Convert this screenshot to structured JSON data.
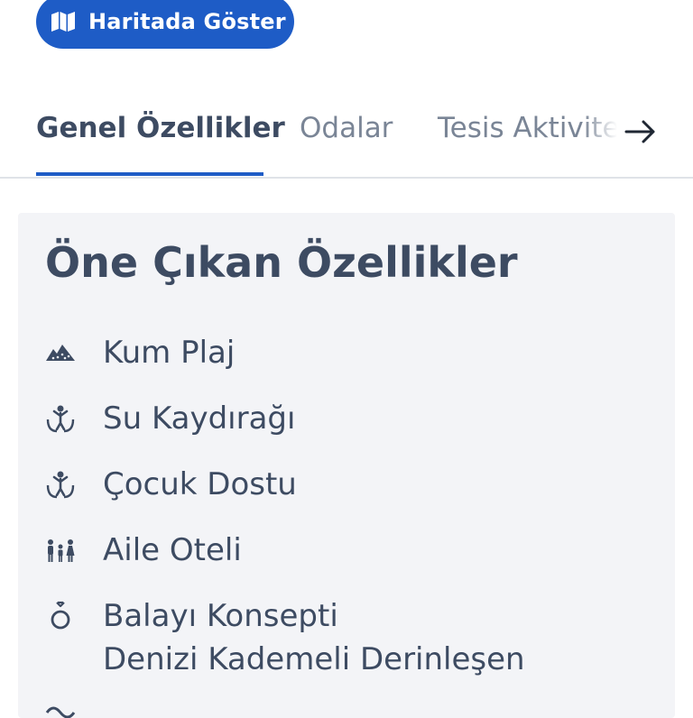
{
  "map_button": {
    "label": "Haritada Göster",
    "icon": "map-icon"
  },
  "tabs": [
    {
      "label": "Genel Özellikler",
      "active": true
    },
    {
      "label": "Odalar",
      "active": false
    },
    {
      "label": "Tesis Aktiviteleri",
      "active": false
    }
  ],
  "tabs_scroll_icon": "arrow-right-icon",
  "features": {
    "title": "Öne Çıkan Özellikler",
    "items": [
      {
        "label": "Kum Plaj",
        "icon": "sand-beach-icon"
      },
      {
        "label": "Su Kaydırağı",
        "icon": "child-hands-icon"
      },
      {
        "label": "Çocuk Dostu",
        "icon": "child-hands-icon"
      },
      {
        "label": "Aile Oteli",
        "icon": "family-icon"
      },
      {
        "label": "Balayı Konsepti",
        "icon": "ring-icon"
      },
      {
        "label": "Denizi Kademeli Derinleşen",
        "icon": "wave-icon"
      }
    ]
  },
  "colors": {
    "brand_blue": "#1e5cc6",
    "text_dark": "#3d4b62",
    "text_muted": "#7a8596",
    "panel_bg": "#f3f4f7",
    "divider": "#dfe3e8"
  }
}
